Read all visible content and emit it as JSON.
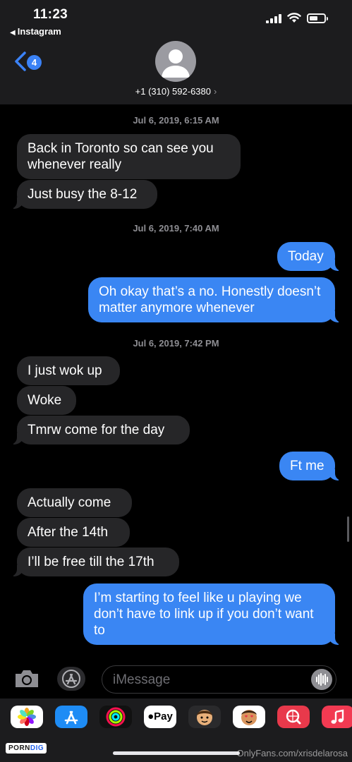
{
  "status_bar": {
    "time": "11:23",
    "back_app": "Instagram"
  },
  "header": {
    "back_badge": "4",
    "contact": "+1 (310) 592-6380",
    "chevron": "›"
  },
  "timestamps": [
    "Jul 6, 2019, 6:15 AM",
    "Jul 6, 2019, 7:40 AM",
    "Jul 6, 2019, 7:42 PM"
  ],
  "messages": [
    {
      "dir": "in",
      "text": "Back in Toronto so can see you whenever really"
    },
    {
      "dir": "in",
      "text": "Just busy the 8-12"
    },
    {
      "dir": "out",
      "text": "Today"
    },
    {
      "dir": "out",
      "text": "Oh okay that’s a no. Honestly doesn’t matter anymore whenever"
    },
    {
      "dir": "in",
      "text": "I just wok up"
    },
    {
      "dir": "in",
      "text": "Woke"
    },
    {
      "dir": "in",
      "text": "Tmrw come for the day"
    },
    {
      "dir": "out",
      "text": "Ft me"
    },
    {
      "dir": "in",
      "text": "Actually come"
    },
    {
      "dir": "in",
      "text": "After the 14th"
    },
    {
      "dir": "in",
      "text": "I’ll be free till the 17th"
    },
    {
      "dir": "out",
      "text": "I’m starting to feel like u playing we don’t have to link up if you don’t want to"
    }
  ],
  "input": {
    "placeholder": "iMessage"
  },
  "apps": [
    {
      "name": "photos-app-icon",
      "color": "#ffffff"
    },
    {
      "name": "app-store-app-icon",
      "color": "#1e8cf5"
    },
    {
      "name": "activity-app-icon",
      "color": "#111111"
    },
    {
      "name": "apple-pay-app-icon",
      "color": "#ffffff",
      "label": "Pay"
    },
    {
      "name": "memoji-app-icon",
      "color": "#2a2a2c"
    },
    {
      "name": "memoji-stickers-app-icon",
      "color": "#ffffff"
    },
    {
      "name": "images-search-app-icon",
      "color": "#e8394b"
    },
    {
      "name": "music-app-icon",
      "color": "#f23a52"
    }
  ],
  "footer": {
    "logo_a": "PORN",
    "logo_b": "DIG",
    "watermark": "OnlyFans.com/xrisdelarosa"
  },
  "colors": {
    "outgoing": "#3a86f3",
    "incoming": "#262628",
    "header": "#1c1c1e"
  }
}
